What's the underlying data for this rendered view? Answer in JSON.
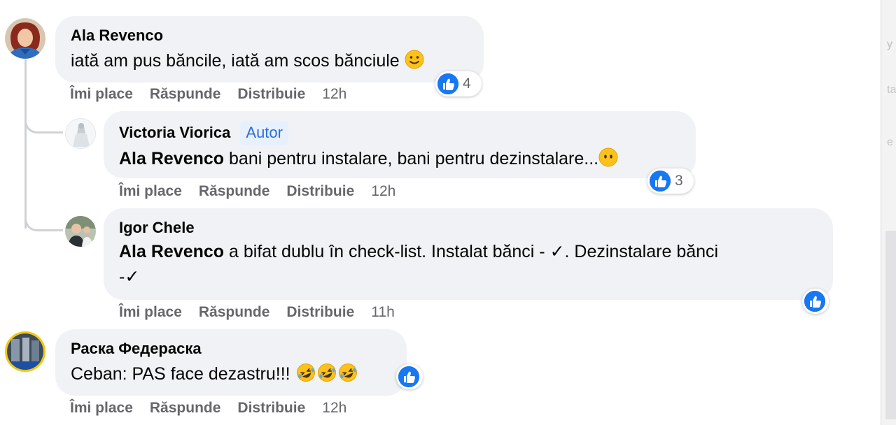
{
  "comments": [
    {
      "author": "Ala Revenco",
      "text": "iată am pus băncile, iată am scos bănciule",
      "emoji": "slightly-smiling-face",
      "reaction_count": "4",
      "actions": {
        "like": "Îmi place",
        "reply": "Răspunde",
        "share": "Distribuie",
        "time": "12h"
      }
    },
    {
      "author": "Victoria Viorica",
      "badge": "Autor",
      "mention": "Ala Revenco",
      "text": " bani pentru instalare, bani pentru dezinstalare...",
      "emoji": "face-without-mouth",
      "reaction_count": "3",
      "actions": {
        "like": "Îmi place",
        "reply": "Răspunde",
        "share": "Distribuie",
        "time": "12h"
      }
    },
    {
      "author": "Igor Chele",
      "mention": "Ala Revenco",
      "text_line1": " a bifat dublu în check-list. Instalat bănci - ✓. Dezinstalare bănci",
      "text_line2": "-✓",
      "actions": {
        "like": "Îmi place",
        "reply": "Răspunde",
        "share": "Distribuie",
        "time": "11h"
      }
    },
    {
      "author": "Раска Федераска",
      "text": "Ceban: PAS face dezastru!!! ",
      "emoji": "rolling-on-floor-laughing x3",
      "actions": {
        "like": "Îmi place",
        "reply": "Răspunde",
        "share": "Distribuie",
        "time": "12h"
      }
    }
  ],
  "colors": {
    "like_blue": "#1877f2",
    "bubble_bg": "#f0f2f5",
    "meta_gray": "#65676b",
    "badge_text": "#2d6fd4",
    "badge_bg": "#e7f0fd"
  }
}
